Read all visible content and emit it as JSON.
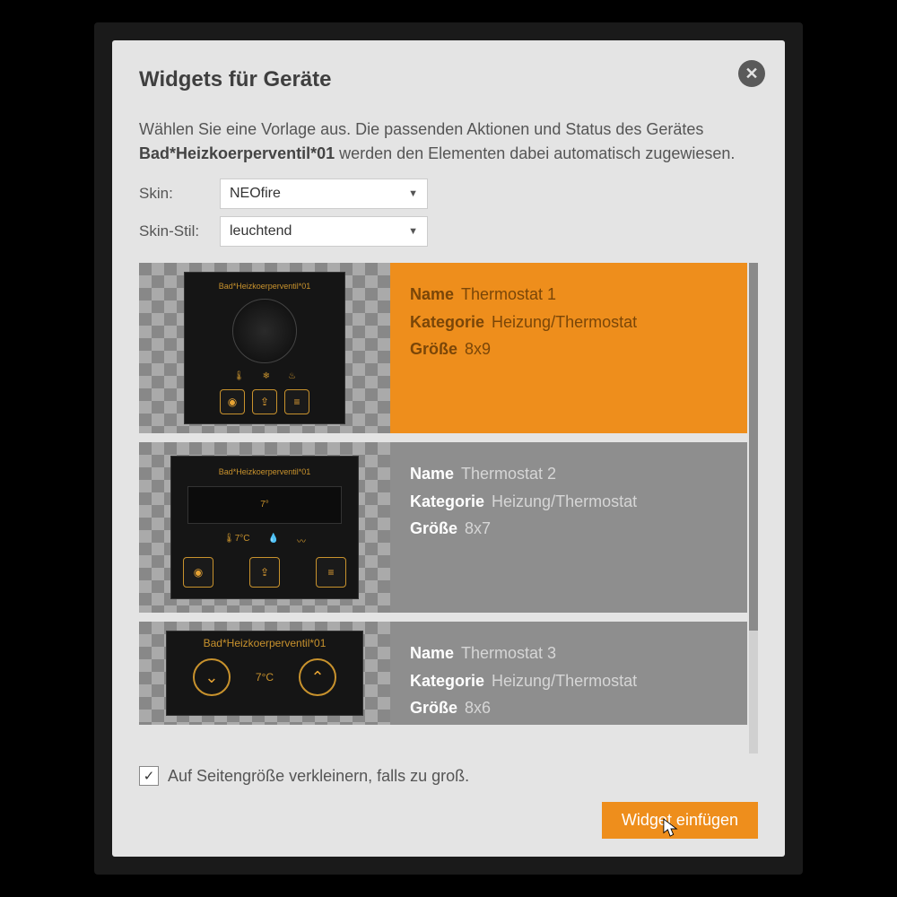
{
  "dialog": {
    "title": "Widgets für Geräte",
    "intro_pre": "Wählen Sie eine Vorlage aus. Die passenden Aktionen und Status des Gerätes ",
    "device": "Bad*Heizkoerperventil*01",
    "intro_post": " werden den Elementen dabei automatisch zugewiesen."
  },
  "form": {
    "skin_label": "Skin:",
    "skin_value": "NEOfire",
    "style_label": "Skin-Stil:",
    "style_value": "leuchtend"
  },
  "labels": {
    "name": "Name",
    "category": "Kategorie",
    "size": "Größe"
  },
  "items": [
    {
      "name": "Thermostat 1",
      "category": "Heizung/Thermostat",
      "size": "8x9",
      "selected": true,
      "preview_title": "Bad*Heizkoerperventil*01"
    },
    {
      "name": "Thermostat 2",
      "category": "Heizung/Thermostat",
      "size": "8x7",
      "selected": false,
      "preview_title": "Bad*Heizkoerperventil*01"
    },
    {
      "name": "Thermostat 3",
      "category": "Heizung/Thermostat",
      "size": "8x6",
      "selected": false,
      "preview_title": "Bad*Heizkoerperventil*01"
    }
  ],
  "footer": {
    "shrink_label": "Auf Seitengröße verkleinern, falls zu groß.",
    "shrink_checked": true,
    "insert_label": "Widget einfügen"
  }
}
